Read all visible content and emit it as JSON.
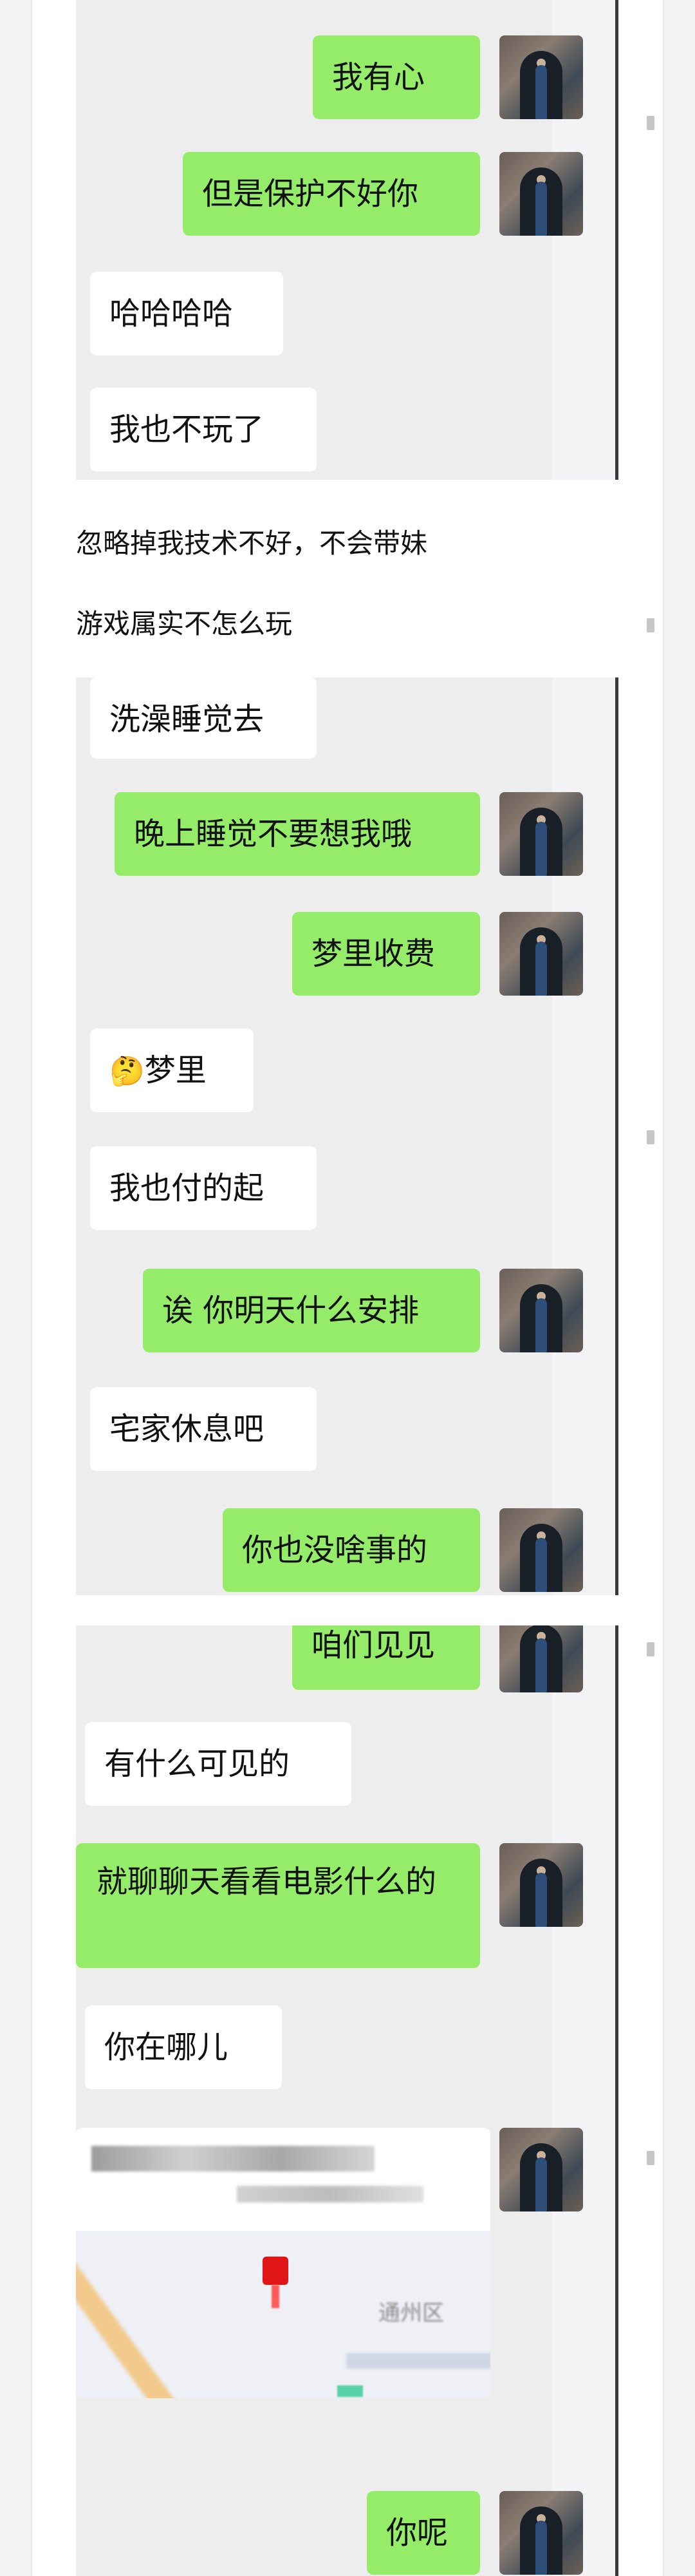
{
  "colors": {
    "chat_background": "#ededed",
    "outgoing_bubble": "#95ec69",
    "incoming_bubble": "#ffffff"
  },
  "section1": {
    "messages": [
      {
        "side": "out",
        "text": "我有心"
      },
      {
        "side": "out",
        "text": "但是保护不好你"
      },
      {
        "side": "in",
        "text": "哈哈哈哈"
      },
      {
        "side": "in",
        "text": "我也不玩了"
      }
    ]
  },
  "notes": {
    "line1": "忽略掉我技术不好，不会带妹",
    "line2": "游戏属实不怎么玩"
  },
  "section2": {
    "messages": [
      {
        "side": "in",
        "text": "洗澡睡觉去"
      },
      {
        "side": "out",
        "text": "晚上睡觉不要想我哦"
      },
      {
        "side": "out",
        "text": "梦里收费"
      },
      {
        "side": "in",
        "text": "梦里",
        "emoji": "🤔"
      },
      {
        "side": "in",
        "text": "我也付的起"
      },
      {
        "side": "out",
        "text": "诶 你明天什么安排"
      },
      {
        "side": "in",
        "text": "宅家休息吧"
      },
      {
        "side": "out",
        "text": "你也没啥事的"
      }
    ]
  },
  "section3": {
    "messages": [
      {
        "side": "out",
        "text": "咱们见见"
      },
      {
        "side": "in",
        "text": "有什么可见的"
      },
      {
        "side": "out",
        "text": "就聊聊天看看电影什么的"
      },
      {
        "side": "in",
        "text": "你在哪儿"
      },
      {
        "side": "out",
        "type": "location",
        "label": "通州区"
      },
      {
        "side": "out",
        "text": "你呢"
      }
    ]
  },
  "icons": {
    "avatar": "user-avatar-photo",
    "location_pin": "map-pin-icon"
  }
}
